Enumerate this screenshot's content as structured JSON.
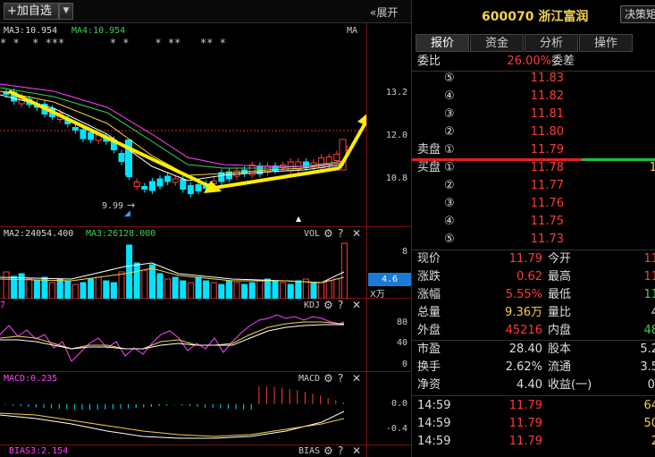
{
  "toolbar": {
    "add_watchlist": "加自选",
    "add_icon": "+",
    "dropdown_icon": "▼",
    "expand": "«展开"
  },
  "kline": {
    "ma3_label": "MA3:10.954",
    "ma4_label": "MA4:10.954",
    "ma_tag": "MA",
    "star_marks": "* *  * ***       * *    * **   ** *",
    "low_marker": "9.99",
    "price_ticks": [
      "13.2",
      "12.0",
      "10.8"
    ]
  },
  "volume": {
    "ma2_label": "MA2:24054.400",
    "ma3_label": "MA3:26128.000",
    "tag": "VOL",
    "tick_top": "8",
    "current": "4.6",
    "unit": "X万"
  },
  "kdj": {
    "left_label": "7",
    "tag": "KDJ",
    "ticks": [
      "80",
      "40",
      "0"
    ]
  },
  "macd": {
    "label": "MACD:0.235",
    "tag": "MACD",
    "ticks": [
      "0.0",
      "-0.4"
    ]
  },
  "bias": {
    "label": "BIAS3:2.154",
    "tag": "BIAS"
  },
  "stock": {
    "code": "600070",
    "name": "浙江富润",
    "policy_btn": "决策矩"
  },
  "tabs": [
    "报价",
    "资金",
    "分析",
    "操作"
  ],
  "orderbook": {
    "wei_bi_label": "委比",
    "wei_bi_value": "26.00%",
    "wei_cha_label": "委差",
    "sell_label": "卖盘",
    "buy_label": "买盘",
    "sell": [
      {
        "lvl": "⑤",
        "price": "11.83"
      },
      {
        "lvl": "④",
        "price": "11.82"
      },
      {
        "lvl": "③",
        "price": "11.81"
      },
      {
        "lvl": "②",
        "price": "11.80"
      },
      {
        "lvl": "①",
        "price": "11.79"
      }
    ],
    "buy": [
      {
        "lvl": "①",
        "price": "11.78",
        "vol": "1"
      },
      {
        "lvl": "②",
        "price": "11.77"
      },
      {
        "lvl": "③",
        "price": "11.76"
      },
      {
        "lvl": "④",
        "price": "11.75"
      },
      {
        "lvl": "⑤",
        "price": "11.73"
      }
    ]
  },
  "quote": [
    {
      "l1": "现价",
      "v1": "11.79",
      "l2": "今开",
      "v2": "11"
    },
    {
      "l1": "涨跌",
      "v1": "0.62",
      "l2": "最高",
      "v2": "11"
    },
    {
      "l1": "涨幅",
      "v1": "5.55%",
      "l2": "最低",
      "v2": "11"
    },
    {
      "l1": "总量",
      "v1": "9.36万",
      "l2": "量比",
      "v2": "4"
    },
    {
      "l1": "外盘",
      "v1": "45216",
      "l2": "内盘",
      "v2": "48"
    }
  ],
  "fundamentals": [
    {
      "l1": "市盈",
      "v1": "28.40",
      "l2": "股本",
      "v2": "5.2"
    },
    {
      "l1": "换手",
      "v1": "2.62%",
      "l2": "流通",
      "v2": "3.5"
    },
    {
      "l1": "净资",
      "v1": "4.40",
      "l2": "收益(一)",
      "v2": "0."
    }
  ],
  "ticks": [
    {
      "time": "14:59",
      "price": "11.79",
      "vol": "64"
    },
    {
      "time": "14:59",
      "price": "11.79",
      "vol": "50"
    },
    {
      "time": "14:59",
      "price": "11.79",
      "vol": "2"
    }
  ],
  "colors": {
    "up": "#ff3b3b",
    "down": "#00e5ff",
    "ma_white": "#ffffff",
    "ma_yellow": "#f2d24b",
    "ma_green": "#39d353",
    "ma_magenta": "#ff44ff",
    "arrow": "#ffee00"
  }
}
